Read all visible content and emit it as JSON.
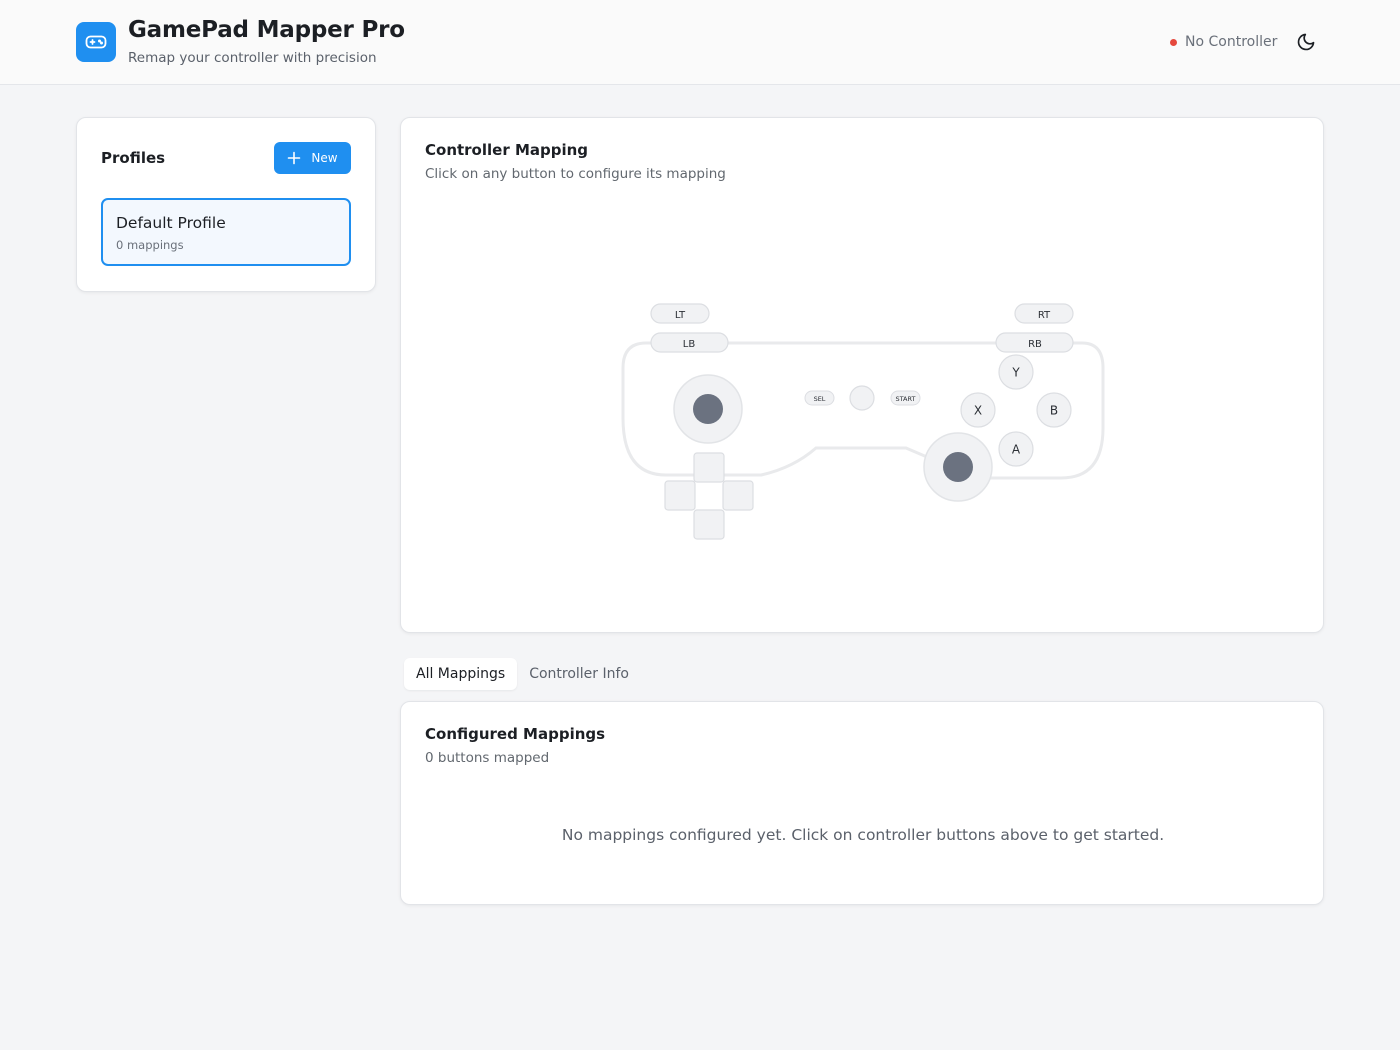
{
  "app": {
    "title": "GamePad Mapper Pro",
    "subtitle": "Remap your controller with precision",
    "logo_icon": "gamepad-icon",
    "accent_color": "#1f8ff0"
  },
  "header": {
    "status_text": "No Controller",
    "status_color": "#e5483d",
    "theme_toggle_icon": "moon-icon"
  },
  "profiles": {
    "title": "Profiles",
    "new_button_label": "New",
    "items": [
      {
        "name": "Default Profile",
        "count_label": "0 mappings",
        "selected": true
      }
    ]
  },
  "controller_mapping": {
    "title": "Controller Mapping",
    "subtitle": "Click on any button to configure its mapping",
    "buttons": {
      "lt": "LT",
      "rt": "RT",
      "lb": "LB",
      "rb": "RB",
      "y": "Y",
      "x": "X",
      "b": "B",
      "a": "A",
      "select": "SEL",
      "start": "START"
    }
  },
  "tabs": [
    {
      "label": "All Mappings",
      "active": true
    },
    {
      "label": "Controller Info",
      "active": false
    }
  ],
  "configured_mappings": {
    "title": "Configured Mappings",
    "subtitle": "0 buttons mapped",
    "empty_message": "No mappings configured yet. Click on controller buttons above to get started."
  }
}
